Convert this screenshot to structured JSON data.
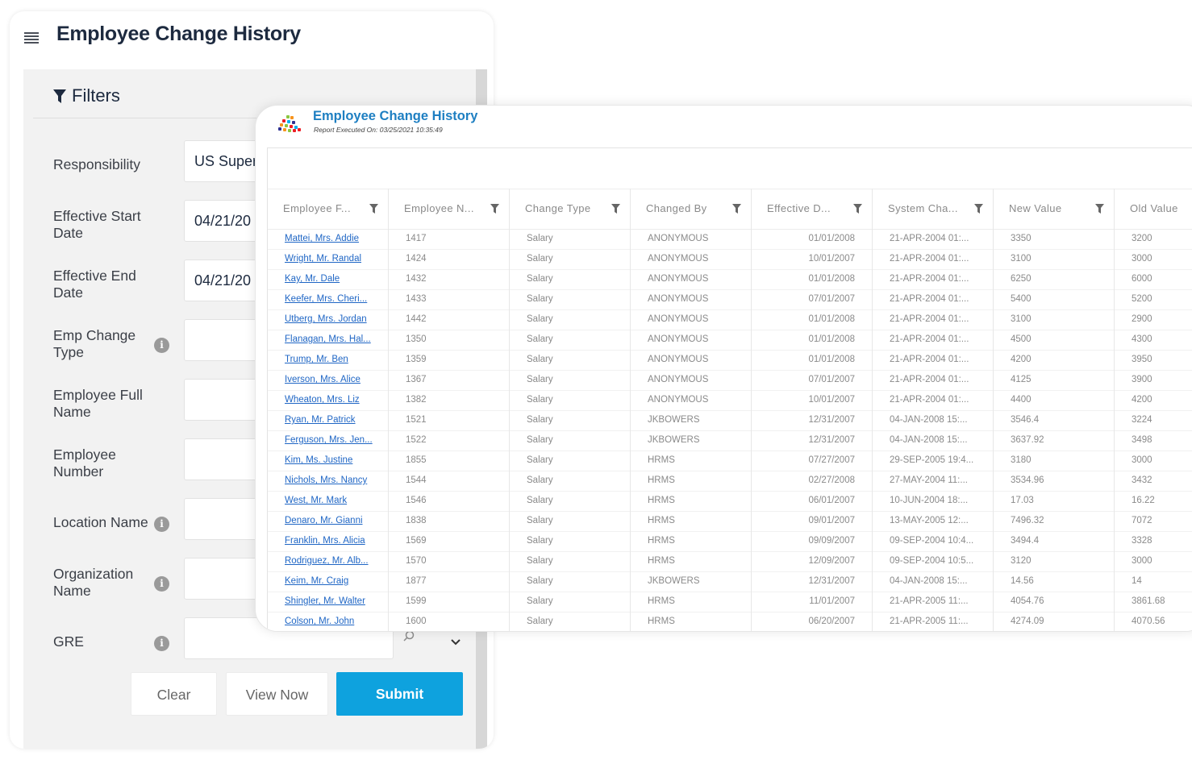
{
  "page": {
    "title": "Employee Change History"
  },
  "filters": {
    "heading": "Filters",
    "fields": [
      {
        "label": "Responsibility",
        "value": "US Super H",
        "info": false
      },
      {
        "label": "Effective Start Date",
        "value": "04/21/20",
        "info": false
      },
      {
        "label": "Effective End Date",
        "value": "04/21/20",
        "info": false
      },
      {
        "label": "Emp Change Type",
        "value": "",
        "info": true
      },
      {
        "label": "Employee Full Name",
        "value": "",
        "info": false
      },
      {
        "label": "Employee Number",
        "value": "",
        "info": false
      },
      {
        "label": "Location Name",
        "value": "",
        "info": true
      },
      {
        "label": "Organization Name",
        "value": "",
        "info": true
      },
      {
        "label": "GRE",
        "value": "",
        "info": true
      }
    ],
    "buttons": {
      "clear": "Clear",
      "view_now": "View Now",
      "submit": "Submit"
    }
  },
  "report": {
    "title": "Employee Change History",
    "subtitle": "Report Executed On: 03/25/2021 10:35:49",
    "columns": [
      "Employee F...",
      "Employee N...",
      "Change Type",
      "Changed By",
      "Effective D...",
      "System Cha...",
      "New Value",
      "Old Value"
    ],
    "rows": [
      [
        "Mattei, Mrs. Addie",
        "1417",
        "Salary",
        "ANONYMOUS",
        "01/01/2008",
        "21-APR-2004 01:...",
        "3350",
        "3200"
      ],
      [
        "Wright, Mr. Randal",
        "1424",
        "Salary",
        "ANONYMOUS",
        "10/01/2007",
        "21-APR-2004 01:...",
        "3100",
        "3000"
      ],
      [
        "Kay, Mr. Dale",
        "1432",
        "Salary",
        "ANONYMOUS",
        "01/01/2008",
        "21-APR-2004 01:...",
        "6250",
        "6000"
      ],
      [
        "Keefer, Mrs. Cheri...",
        "1433",
        "Salary",
        "ANONYMOUS",
        "07/01/2007",
        "21-APR-2004 01:...",
        "5400",
        "5200"
      ],
      [
        "Utberg, Mrs. Jordan",
        "1442",
        "Salary",
        "ANONYMOUS",
        "01/01/2008",
        "21-APR-2004 01:...",
        "3100",
        "2900"
      ],
      [
        "Flanagan, Mrs. Hal...",
        "1350",
        "Salary",
        "ANONYMOUS",
        "01/01/2008",
        "21-APR-2004 01:...",
        "4500",
        "4300"
      ],
      [
        "Trump, Mr. Ben",
        "1359",
        "Salary",
        "ANONYMOUS",
        "01/01/2008",
        "21-APR-2004 01:...",
        "4200",
        "3950"
      ],
      [
        "Iverson, Mrs. Alice",
        "1367",
        "Salary",
        "ANONYMOUS",
        "07/01/2007",
        "21-APR-2004 01:...",
        "4125",
        "3900"
      ],
      [
        "Wheaton, Mrs. Liz",
        "1382",
        "Salary",
        "ANONYMOUS",
        "10/01/2007",
        "21-APR-2004 01:...",
        "4400",
        "4200"
      ],
      [
        "Ryan, Mr. Patrick",
        "1521",
        "Salary",
        "JKBOWERS",
        "12/31/2007",
        "04-JAN-2008 15:...",
        "3546.4",
        "3224"
      ],
      [
        "Ferguson, Mrs. Jen...",
        "1522",
        "Salary",
        "JKBOWERS",
        "12/31/2007",
        "04-JAN-2008 15:...",
        "3637.92",
        "3498"
      ],
      [
        "Kim, Ms. Justine",
        "1855",
        "Salary",
        "HRMS",
        "07/27/2007",
        "29-SEP-2005 19:4...",
        "3180",
        "3000"
      ],
      [
        "Nichols, Mrs. Nancy",
        "1544",
        "Salary",
        "HRMS",
        "02/27/2008",
        "27-MAY-2004 11:...",
        "3534.96",
        "3432"
      ],
      [
        "West, Mr. Mark",
        "1546",
        "Salary",
        "HRMS",
        "06/01/2007",
        "10-JUN-2004 18:...",
        "17.03",
        "16.22"
      ],
      [
        "Denaro, Mr. Gianni",
        "1838",
        "Salary",
        "HRMS",
        "09/01/2007",
        "13-MAY-2005 12:...",
        "7496.32",
        "7072"
      ],
      [
        "Franklin, Mrs. Alicia",
        "1569",
        "Salary",
        "HRMS",
        "09/09/2007",
        "09-SEP-2004 10:4...",
        "3494.4",
        "3328"
      ],
      [
        "Rodriguez, Mr. Alb...",
        "1570",
        "Salary",
        "HRMS",
        "12/09/2007",
        "09-SEP-2004 10:5...",
        "3120",
        "3000"
      ],
      [
        "Keim, Mr. Craig",
        "1877",
        "Salary",
        "JKBOWERS",
        "12/31/2007",
        "04-JAN-2008 15:...",
        "14.56",
        "14"
      ],
      [
        "Shingler, Mr. Walter",
        "1599",
        "Salary",
        "HRMS",
        "11/01/2007",
        "21-APR-2005 11:...",
        "4054.76",
        "3861.68"
      ],
      [
        "Colson, Mr. John",
        "1600",
        "Salary",
        "HRMS",
        "06/20/2007",
        "21-APR-2005 11:...",
        "4274.09",
        "4070.56"
      ]
    ]
  },
  "icons": {
    "menu": "hamburger-menu-icon",
    "filter": "funnel-icon",
    "info": "info-icon",
    "search": "search-icon",
    "dropdown": "chevron-down-icon",
    "logo": "app-logo-icon"
  },
  "colors": {
    "accent": "#0ea2de",
    "title": "#1d2a3f",
    "link": "#1f66c5",
    "report_title": "#1e7fc2"
  }
}
